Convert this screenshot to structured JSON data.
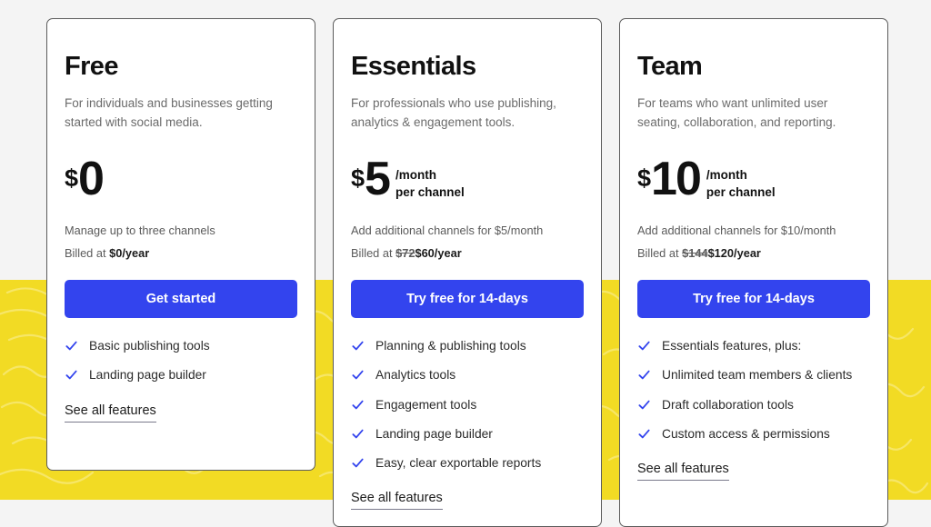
{
  "theme": {
    "accent_blue": "#3344EE",
    "band_yellow": "#F2DB24",
    "page_background": "#F4F4F4",
    "card_background": "#FFFFFF",
    "card_border": "#5C5C5C"
  },
  "plans": [
    {
      "name": "Free",
      "description": "For individuals and businesses getting started with social media.",
      "currency": "$",
      "amount": "0",
      "per_primary": "",
      "per_secondary": "",
      "note_one": "Manage up to three channels",
      "note_billed_label": "Billed at ",
      "note_old_price": "",
      "note_price": "$0/year",
      "cta_label": "Get started",
      "features": [
        "Basic publishing tools",
        "Landing page builder"
      ],
      "see_all_label": "See all features"
    },
    {
      "name": "Essentials",
      "description": "For professionals who use publishing, analytics & engagement tools.",
      "currency": "$",
      "amount": "5",
      "per_primary": "/month",
      "per_secondary": "per channel",
      "note_one": "Add additional channels for $5/month",
      "note_billed_label": "Billed at ",
      "note_old_price": "$72",
      "note_price": "$60/year",
      "cta_label": "Try free for 14-days",
      "features": [
        "Planning & publishing tools",
        "Analytics tools",
        "Engagement tools",
        "Landing page builder",
        "Easy, clear exportable reports"
      ],
      "see_all_label": "See all features"
    },
    {
      "name": "Team",
      "description": "For teams who want unlimited user seating, collaboration, and reporting.",
      "currency": "$",
      "amount": "10",
      "per_primary": "/month",
      "per_secondary": "per channel",
      "note_one": "Add additional channels for $10/month",
      "note_billed_label": "Billed at ",
      "note_old_price": "$144",
      "note_price": "$120/year",
      "cta_label": "Try free for 14-days",
      "features": [
        "Essentials features, plus:",
        "Unlimited team members & clients",
        "Draft collaboration tools",
        "Custom access & permissions"
      ],
      "see_all_label": "See all features"
    }
  ]
}
